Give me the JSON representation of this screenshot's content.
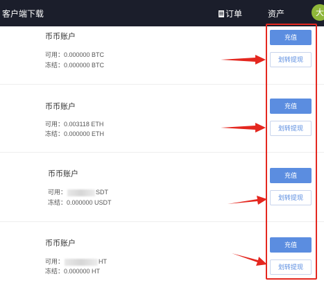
{
  "topbar": {
    "download_label": "客户端下载",
    "orders_label": "订单",
    "assets_label": "资产",
    "avatar_initial": "大"
  },
  "accounts": [
    {
      "title": "币币账户",
      "available": "可用：0.000000 BTC",
      "frozen": "冻结：0.000000 BTC",
      "recharge": "充值",
      "transfer": "划转提现"
    },
    {
      "title": "币币账户",
      "available": "可用：0.003118 ETH",
      "frozen": "冻结：0.000000 ETH",
      "recharge": "充值",
      "transfer": "划转提现"
    },
    {
      "title": "币币账户",
      "available_prefix": "可用：",
      "available_suffix": "SDT",
      "frozen": "冻结：0.000000 USDT",
      "recharge": "充值",
      "transfer": "划转提现"
    },
    {
      "title": "币币账户",
      "available_prefix": "可用：",
      "available_suffix": "HT",
      "frozen": "冻结：0.000000 HT",
      "recharge": "充值",
      "transfer": "划转提现"
    }
  ],
  "colors": {
    "topbar_bg": "#1b1e2b",
    "primary_button": "#5b8de0",
    "annotation_red": "#e4271f"
  }
}
